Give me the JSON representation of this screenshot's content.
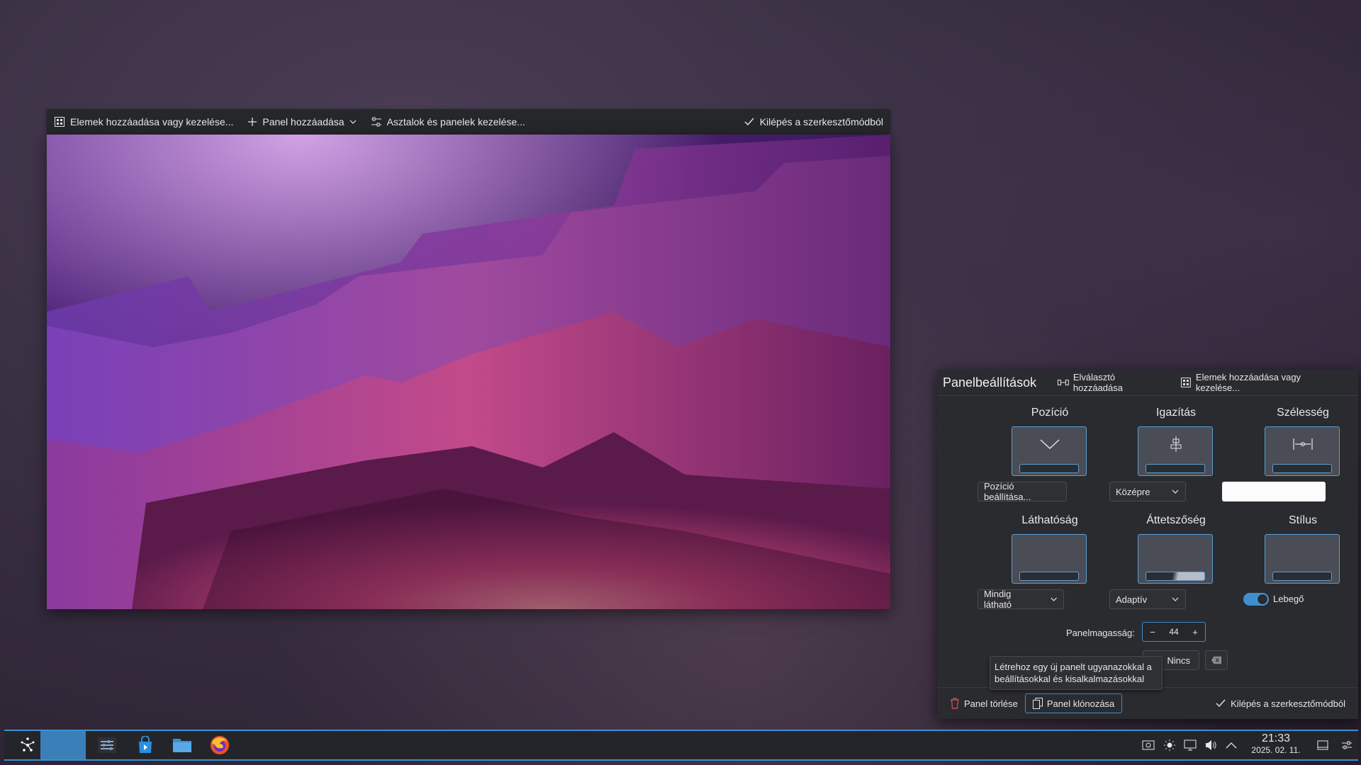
{
  "toolbar": {
    "add_widgets": "Elemek hozzáadása vagy kezelése...",
    "add_panel": "Panel hozzáadása",
    "manage_desktops": "Asztalok és panelek kezelése...",
    "exit_edit": "Kilépés a szerkesztőmódból"
  },
  "panel_settings": {
    "title": "Panelbeállítások",
    "add_spacer": "Elválasztó hozzáadása",
    "add_widgets": "Elemek hozzáadása vagy kezelése...",
    "position": {
      "label": "Pozíció",
      "button": "Pozíció beállítása..."
    },
    "alignment": {
      "label": "Igazítás",
      "value": "Középre"
    },
    "width": {
      "label": "Szélesség",
      "value": ""
    },
    "visibility": {
      "label": "Láthatóság",
      "value": "Mindig látható"
    },
    "opacity": {
      "label": "Áttetszőség",
      "value": "Adaptív"
    },
    "style": {
      "label": "Stílus",
      "toggle_label": "Lebegő",
      "floating": true
    },
    "panel_height": {
      "label": "Panelmagasság:",
      "value": "44",
      "minus": "−",
      "plus": "+"
    },
    "shortcut": {
      "value": "Nincs"
    },
    "tooltip": "Létrehoz egy új panelt ugyanazokkal a beállításokkal és kisalkalmazásokkal",
    "delete_panel": "Panel törlése",
    "clone_panel": "Panel klónozása",
    "exit_edit": "Kilépés a szerkesztőmódból"
  },
  "taskbar": {
    "apps": [
      "app-launcher-icon",
      "active-window",
      "system-settings-icon",
      "discover-icon",
      "file-manager-icon",
      "firefox-icon"
    ],
    "tray": [
      "screenshot-icon",
      "brightness-icon",
      "display-icon",
      "volume-icon",
      "expand-tray-icon"
    ],
    "clock": {
      "time": "21:33",
      "date": "2025. 02. 11."
    }
  },
  "colors": {
    "accent": "#3d8fd1",
    "panel_bg": "#2a2b2f"
  }
}
